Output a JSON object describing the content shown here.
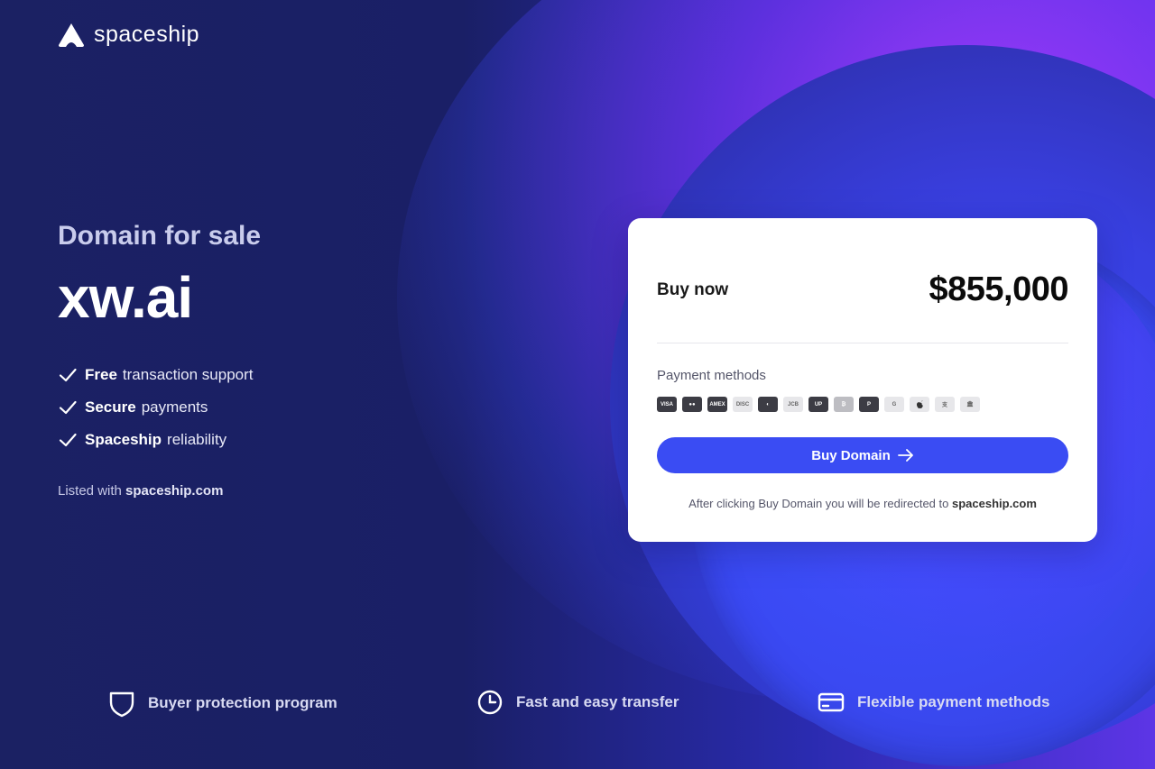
{
  "brand": {
    "name": "spaceship"
  },
  "hero": {
    "subtitle": "Domain for sale",
    "domain": "xw.ai",
    "features": [
      {
        "bold": "Free",
        "text": "transaction support"
      },
      {
        "bold": "Secure",
        "text": "payments"
      },
      {
        "bold": "Spaceship",
        "text": "reliability"
      }
    ],
    "listed_prefix": "Listed with",
    "listed_link": "spaceship.com"
  },
  "card": {
    "buy_now_label": "Buy now",
    "price": "$855,000",
    "payment_methods_label": "Payment methods",
    "payment_icons": [
      {
        "name": "visa-icon",
        "label": "VISA"
      },
      {
        "name": "mastercard-icon",
        "label": "●●"
      },
      {
        "name": "amex-icon",
        "label": "AMEX"
      },
      {
        "name": "discover-icon",
        "label": "DISC"
      },
      {
        "name": "diners-club-icon",
        "label": "◐"
      },
      {
        "name": "jcb-icon",
        "label": "JCB"
      },
      {
        "name": "unionpay-icon",
        "label": "UP"
      },
      {
        "name": "bitcoin-icon",
        "label": "₿"
      },
      {
        "name": "paypal-icon",
        "label": "P"
      },
      {
        "name": "google-pay-icon",
        "label": "G"
      },
      {
        "name": "apple-pay-icon",
        "label": ""
      },
      {
        "name": "alipay-icon",
        "label": "支"
      },
      {
        "name": "bank-transfer-icon",
        "label": "🏛"
      }
    ],
    "buy_button_label": "Buy Domain",
    "redirect_text": "After clicking Buy Domain you will be redirected to",
    "redirect_link": "spaceship.com"
  },
  "bottom": {
    "items": [
      {
        "icon": "shield-icon",
        "label": "Buyer protection program"
      },
      {
        "icon": "clock-icon",
        "label": "Fast and easy transfer"
      },
      {
        "icon": "credit-card-icon",
        "label": "Flexible payment methods"
      }
    ]
  },
  "colors": {
    "accent": "#3a4cf3",
    "background": "#1a1f63",
    "gradient_highlight": "#8a3dff"
  }
}
